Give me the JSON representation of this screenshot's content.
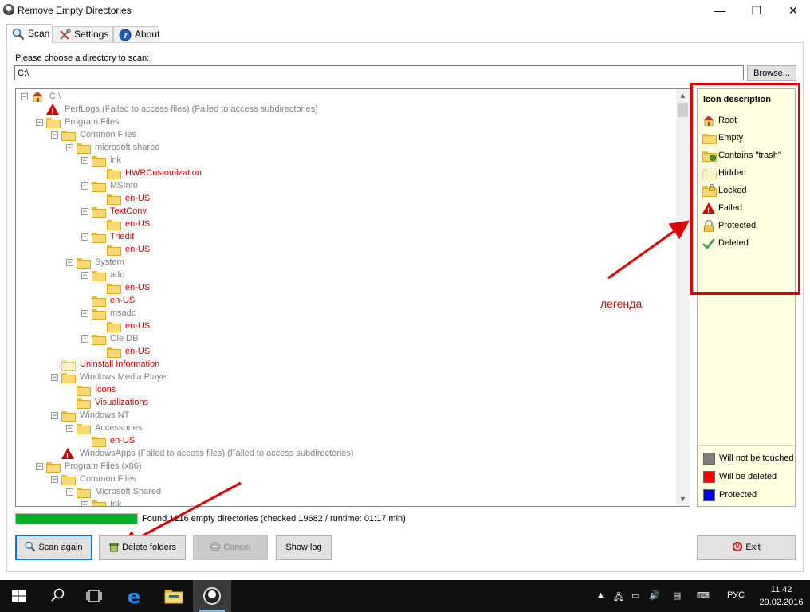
{
  "window": {
    "title": "Remove Empty Directories",
    "minimize_glyph": "—",
    "maximize_glyph": "❐",
    "close_glyph": "✕"
  },
  "tabs": [
    {
      "label": "Scan",
      "icon": "magnifier-icon",
      "active": true
    },
    {
      "label": "Settings",
      "icon": "tools-icon",
      "active": false
    },
    {
      "label": "About",
      "icon": "help-icon",
      "active": false
    }
  ],
  "scan": {
    "choose_label": "Please choose a directory to scan:",
    "directory_value": "C:\\",
    "browse_label": "Browse..."
  },
  "tree": [
    {
      "text": "C:\\",
      "icon": "root",
      "level": 0,
      "color": "gray",
      "toggle": "-"
    },
    {
      "text": "PerfLogs (Failed to access files) (Failed to access subdirectories)",
      "icon": "failed",
      "level": 1,
      "color": "gray",
      "toggle": ""
    },
    {
      "text": "Program Files",
      "icon": "folder",
      "level": 1,
      "color": "gray",
      "toggle": "-"
    },
    {
      "text": "Common Files",
      "icon": "folder",
      "level": 2,
      "color": "gray",
      "toggle": "-"
    },
    {
      "text": "microsoft shared",
      "icon": "folder",
      "level": 3,
      "color": "gray",
      "toggle": "-"
    },
    {
      "text": "ink",
      "icon": "folder",
      "level": 4,
      "color": "gray",
      "toggle": "-"
    },
    {
      "text": "HWRCustomization",
      "icon": "folder",
      "level": 5,
      "color": "red",
      "toggle": ""
    },
    {
      "text": "MSInfo",
      "icon": "folder",
      "level": 4,
      "color": "gray",
      "toggle": "-"
    },
    {
      "text": "en-US",
      "icon": "folder",
      "level": 5,
      "color": "red",
      "toggle": ""
    },
    {
      "text": "TextConv",
      "icon": "folder",
      "level": 4,
      "color": "red",
      "toggle": "-"
    },
    {
      "text": "en-US",
      "icon": "folder",
      "level": 5,
      "color": "red",
      "toggle": ""
    },
    {
      "text": "Triedit",
      "icon": "folder",
      "level": 4,
      "color": "red",
      "toggle": "-"
    },
    {
      "text": "en-US",
      "icon": "folder",
      "level": 5,
      "color": "red",
      "toggle": ""
    },
    {
      "text": "System",
      "icon": "folder",
      "level": 3,
      "color": "gray",
      "toggle": "-"
    },
    {
      "text": "ado",
      "icon": "folder",
      "level": 4,
      "color": "gray",
      "toggle": "-"
    },
    {
      "text": "en-US",
      "icon": "folder",
      "level": 5,
      "color": "red",
      "toggle": ""
    },
    {
      "text": "en-US",
      "icon": "folder",
      "level": 4,
      "color": "red",
      "toggle": ""
    },
    {
      "text": "msadc",
      "icon": "folder",
      "level": 4,
      "color": "gray",
      "toggle": "-"
    },
    {
      "text": "en-US",
      "icon": "folder",
      "level": 5,
      "color": "red",
      "toggle": ""
    },
    {
      "text": "Ole DB",
      "icon": "folder",
      "level": 4,
      "color": "gray",
      "toggle": "-"
    },
    {
      "text": "en-US",
      "icon": "folder",
      "level": 5,
      "color": "red",
      "toggle": ""
    },
    {
      "text": "Uninstall Information",
      "icon": "hidden",
      "level": 2,
      "color": "red",
      "toggle": ""
    },
    {
      "text": "Windows Media Player",
      "icon": "folder",
      "level": 2,
      "color": "gray",
      "toggle": "-"
    },
    {
      "text": "Icons",
      "icon": "folder",
      "level": 3,
      "color": "red",
      "toggle": ""
    },
    {
      "text": "Visualizations",
      "icon": "folder",
      "level": 3,
      "color": "red",
      "toggle": ""
    },
    {
      "text": "Windows NT",
      "icon": "folder",
      "level": 2,
      "color": "gray",
      "toggle": "-"
    },
    {
      "text": "Accessories",
      "icon": "folder",
      "level": 3,
      "color": "gray",
      "toggle": "-"
    },
    {
      "text": "en-US",
      "icon": "folder",
      "level": 4,
      "color": "red",
      "toggle": ""
    },
    {
      "text": "WindowsApps (Failed to access files) (Failed to access subdirectories)",
      "icon": "failed",
      "level": 2,
      "color": "gray",
      "toggle": ""
    },
    {
      "text": "Program Files (x86)",
      "icon": "folder",
      "level": 1,
      "color": "gray",
      "toggle": "-"
    },
    {
      "text": "Common Files",
      "icon": "folder",
      "level": 2,
      "color": "gray",
      "toggle": "-"
    },
    {
      "text": "Microsoft Shared",
      "icon": "folder",
      "level": 3,
      "color": "gray",
      "toggle": "-"
    },
    {
      "text": "Ink",
      "icon": "folder",
      "level": 4,
      "color": "gray",
      "toggle": "-"
    }
  ],
  "legend": {
    "title": "Icon description",
    "items": [
      {
        "label": "Root",
        "icon": "root"
      },
      {
        "label": "Empty",
        "icon": "folder"
      },
      {
        "label": "Contains \"trash\"",
        "icon": "trash-folder"
      },
      {
        "label": "Hidden",
        "icon": "hidden"
      },
      {
        "label": "Locked",
        "icon": "locked"
      },
      {
        "label": "Failed",
        "icon": "failed"
      },
      {
        "label": "Protected",
        "icon": "protected"
      },
      {
        "label": "Deleted",
        "icon": "deleted"
      }
    ],
    "colors": [
      {
        "label": "Will not be touched",
        "color": "#808080"
      },
      {
        "label": "Will be deleted",
        "color": "#ff0000"
      },
      {
        "label": "Protected",
        "color": "#0000ff"
      }
    ]
  },
  "annotation": {
    "text": "легенда",
    "color": "#e00000"
  },
  "status": {
    "text": "Found 1216 empty directories (checked 19682 / runtime: 01:17 min)",
    "progress_fraction": 1.0,
    "progress_color": "#06b025"
  },
  "buttons": {
    "scan_again": "Scan again",
    "delete_folders": "Delete folders",
    "cancel": "Cancel",
    "show_log": "Show log",
    "exit": "Exit"
  },
  "taskbar": {
    "language": "РУС",
    "time": "11:42",
    "date": "29.02.2016"
  }
}
